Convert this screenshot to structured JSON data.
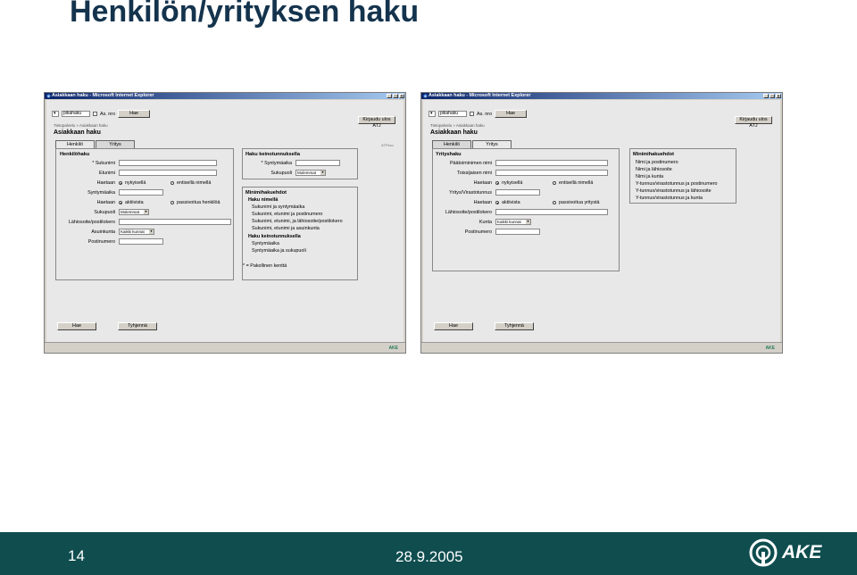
{
  "slide": {
    "title": "Henkilön/yrityksen haku",
    "page_number": "14",
    "date": "28.9.2005",
    "logo_text": "AKE"
  },
  "left": {
    "titlebar": "Asiakkaan haku - Microsoft Internet Explorer",
    "search_value": "pikahaku",
    "checkbox_label": "As. nro",
    "search_button": "Hae",
    "login_button": "Kirjaudu ulos ATJ",
    "breadcrumb": "Tietopalvelu » Asiakkaan haku",
    "heading": "Asiakkaan haku",
    "tabs": [
      "Henkilö",
      "Yritys"
    ],
    "person_panel": {
      "title": "Henkilöhaku",
      "surname": "* Sukunimi",
      "firstname": "Etunimi",
      "search_label": "Haetaan",
      "opt_current": "nykyisellä",
      "opt_former": "entisellä nimellä",
      "birthdate": "Syntymäaika",
      "search_label2": "Haetaan",
      "opt_active": "aktiivista",
      "opt_passive": "passivoitua henkilöä",
      "gender": "Sukupuoli",
      "gender_value": "Molemmat",
      "address": "Lähiosoite/postilokero",
      "municipality": "Asuinkunta",
      "municipality_value": "Kaikki kunnat",
      "postcode": "Postinumero"
    },
    "artificial_panel": {
      "title": "Haku keinotunnuksella",
      "birthdate": "* Syntymäaika",
      "gender": "Sukupuoli",
      "gender_value": "Molemmat"
    },
    "min_panel": {
      "title": "Minimihakuehdot",
      "by_name": "Haku nimellä",
      "items": [
        "Sukunimi ja syntymäaika",
        "Sukunimi, etunimi ja postinumero",
        "Sukunimi, etunimi, ja lähiosoite/postilokero",
        "Sukunimi, etunimi ja asuinkunta"
      ],
      "by_artificial": "Haku keinotunnuksella",
      "items2": [
        "Syntymäaika",
        "Syntymäaika ja sukupuoli"
      ],
      "required": "* = Pakollinen kenttä"
    },
    "atp": "ATPsso",
    "buttons": {
      "search": "Hae",
      "clear": "Tyhjennä"
    }
  },
  "right": {
    "titlebar": "Asiakkaan haku - Microsoft Internet Explorer",
    "search_value": "pikahaku",
    "checkbox_label": "As. nro",
    "search_button": "Hae",
    "login_button": "Kirjaudu ulos ATJ",
    "breadcrumb": "Tietopalvelu » Asiakkaan haku",
    "heading": "Asiakkaan haku",
    "tabs": [
      "Henkilö",
      "Yritys"
    ],
    "company_panel": {
      "title": "Yrityshaku",
      "main_name": "Päätoiminimen nimi",
      "aux_name": "Toissijaisen nimi",
      "search_label": "Haetaan",
      "opt_current": "nykyisellä",
      "opt_former": "entisellä nimellä",
      "business_id": "Yritys/Virastotunnus",
      "search_label2": "Haetaan",
      "opt_active": "aktiivista",
      "opt_passive": "passivoitua yritystä",
      "address": "Lähiosoite/postilokero",
      "municipality": "Kunta",
      "municipality_value": "Kaikki kunnat",
      "postcode": "Postinumero"
    },
    "min_panel": {
      "title": "Minimihakuehdot",
      "items": [
        "Nimi ja postinumero",
        "Nimi ja lähiosoite",
        "Nimi ja kunta",
        "Y-tunnus/virastotunnus ja postinumero",
        "Y-tunnus/virastotunnus ja lähiosoite",
        "Y-tunnus/virastotunnus ja kunta"
      ]
    },
    "buttons": {
      "search": "Hae",
      "clear": "Tyhjennä"
    }
  }
}
